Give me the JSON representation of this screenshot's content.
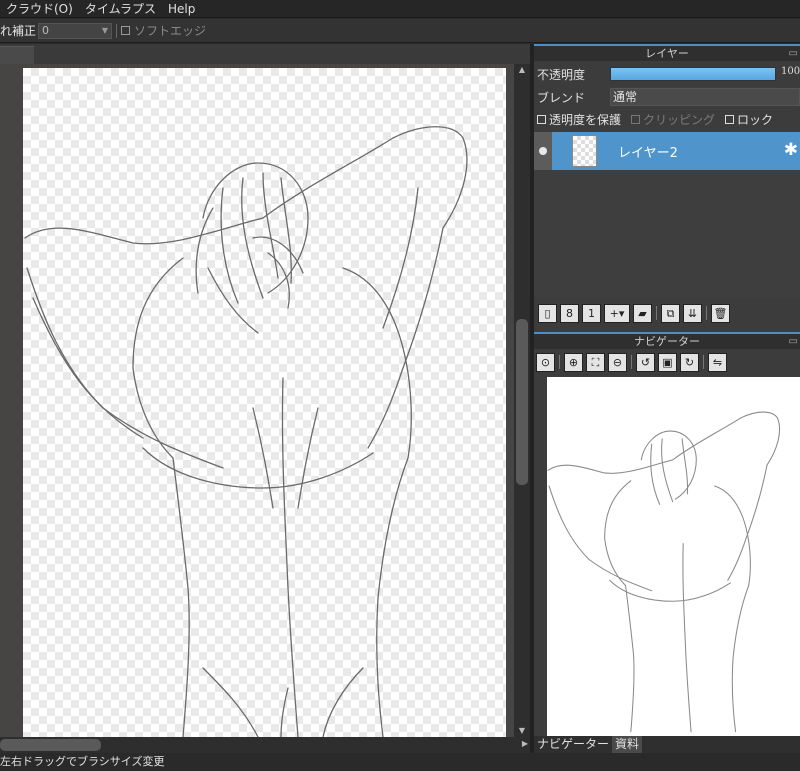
{
  "menu": {
    "items": [
      "クラウド(O)",
      "タイムラプス",
      "Help"
    ]
  },
  "toolbar": {
    "stabilizer_label": "れ補正",
    "stabilizer_value": "0",
    "soft_edge_label": "ソフトエッジ"
  },
  "layer_panel": {
    "title": "レイヤー",
    "opacity_label": "不透明度",
    "opacity_value": "100",
    "opacity_fraction": 1.0,
    "blend_label": "ブレンド",
    "blend_value": "通常",
    "options": {
      "protect_alpha": "透明度を保護",
      "clipping": "クリッピング",
      "lock": "ロック"
    },
    "layers": [
      {
        "name": "レイヤー2",
        "selected": true,
        "visible": true
      }
    ]
  },
  "navigator_panel": {
    "title": "ナビゲーター"
  },
  "bottom_tabs": {
    "navigator": "ナビゲーター",
    "materials": "資料"
  },
  "status": {
    "text": "左右ドラッグでブラシサイズ変更"
  },
  "colors": {
    "accent": "#4f95cc",
    "opacity_bar": "#6bb8ee",
    "background": "#2b2b2b"
  },
  "icons": {
    "layer_tools": [
      "new-layer-icon",
      "new-8bit-layer-icon",
      "new-1bit-layer-icon",
      "add-layer-menu-icon",
      "folder-icon",
      "duplicate-layer-icon",
      "merge-down-icon",
      "delete-layer-icon"
    ],
    "nav_tools": [
      "zoom-reset-icon",
      "zoom-in-icon",
      "fit-icon",
      "zoom-out-icon",
      "rotate-left-icon",
      "actual-size-icon",
      "rotate-right-icon",
      "flip-horizontal-icon"
    ]
  }
}
